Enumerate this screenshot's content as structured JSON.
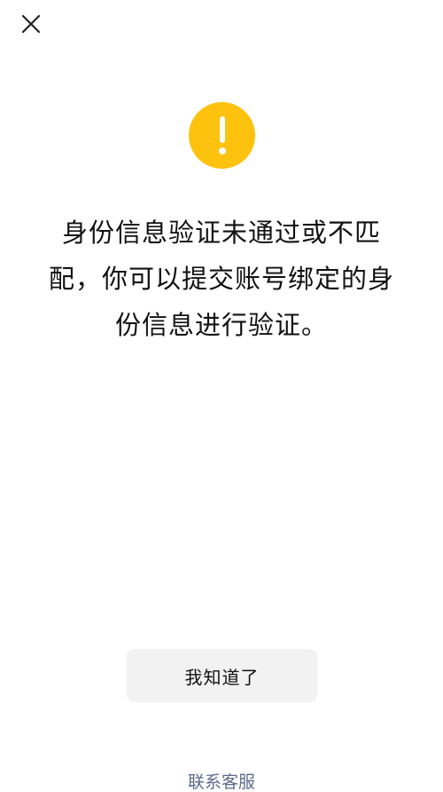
{
  "dialog": {
    "close_icon": "close-icon",
    "warning_icon": "exclamation-circle-icon",
    "warning_color": "#FCC20E",
    "message": "身份信息验证未通过或不匹配，你可以提交账号绑定的身份信息进行验证。",
    "ok_button_label": "我知道了",
    "support_link_label": "联系客服",
    "support_link_color": "#5A6B8C"
  }
}
